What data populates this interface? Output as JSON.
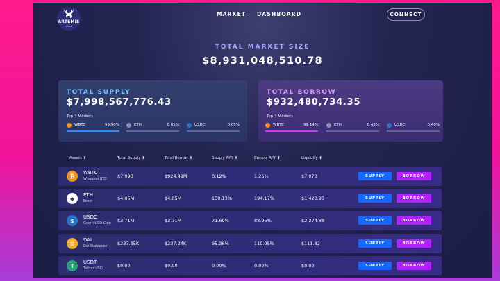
{
  "header": {
    "brand": "ARTEMIS",
    "brand_sub": "aave",
    "nav": [
      "MARKET",
      "DASHBOARD"
    ],
    "connect_label": "CONNECT"
  },
  "market": {
    "label": "TOTAL MARKET SIZE",
    "value": "$8,931,048,510.78"
  },
  "supply_card": {
    "title": "TOTAL SUPPLY",
    "value": "$7,998,567,776.43",
    "top3_label": "Top 3 Markets",
    "markets": [
      {
        "name": "WBTC",
        "pct": "99.90%",
        "fill": 0.999,
        "color": "#f7931a"
      },
      {
        "name": "ETH",
        "pct": "0.05%",
        "fill": 0.0,
        "color": "#8a92b2"
      },
      {
        "name": "USDC",
        "pct": "0.05%",
        "fill": 0.0,
        "color": "#2775ca"
      }
    ]
  },
  "borrow_card": {
    "title": "TOTAL BORROW",
    "value": "$932,480,734.35",
    "top3_label": "Top 3 Markets",
    "markets": [
      {
        "name": "WBTC",
        "pct": "99.14%",
        "fill": 0.9914,
        "color": "#f7931a"
      },
      {
        "name": "ETH",
        "pct": "0.43%",
        "fill": 0.0043,
        "color": "#8a92b2"
      },
      {
        "name": "USDC",
        "pct": "0.40%",
        "fill": 0.004,
        "color": "#2775ca"
      }
    ]
  },
  "table": {
    "headers": [
      "Assets",
      "Total Supply",
      "Total Borrow",
      "Supply APY",
      "Borrow APY",
      "Liquidity"
    ],
    "supply_label": "SUPPLY",
    "borrow_label": "BORROW",
    "rows": [
      {
        "symbol": "WBTC",
        "name": "Wrapped BTC",
        "icon_color": "#f7931a",
        "icon_glyph": "₿",
        "total_supply": "$7.99B",
        "total_borrow": "$924.49M",
        "supply_apy": "0.12%",
        "borrow_apy": "1.25%",
        "liquidity": "$7.07B"
      },
      {
        "symbol": "ETH",
        "name": "Ether",
        "icon_color": "#ffffff",
        "icon_glyph": "◆",
        "total_supply": "$4.05M",
        "total_borrow": "$4.05M",
        "supply_apy": "150.13%",
        "borrow_apy": "194.17%",
        "liquidity": "$1,420.93"
      },
      {
        "symbol": "USDC",
        "name": "Goerli USD Coin",
        "icon_color": "#2775ca",
        "icon_glyph": "$",
        "total_supply": "$3.71M",
        "total_borrow": "$3.71M",
        "supply_apy": "71.69%",
        "borrow_apy": "88.95%",
        "liquidity": "$2,274.88"
      },
      {
        "symbol": "DAI",
        "name": "Dai Stablecoin",
        "icon_color": "#f5ac37",
        "icon_glyph": "≡",
        "total_supply": "$237.35K",
        "total_borrow": "$237.24K",
        "supply_apy": "95.36%",
        "borrow_apy": "119.95%",
        "liquidity": "$111.82"
      },
      {
        "symbol": "USDT",
        "name": "Tether USD",
        "icon_color": "#26a17b",
        "icon_glyph": "T",
        "total_supply": "$0.00",
        "total_borrow": "$0.00",
        "supply_apy": "0.00%",
        "borrow_apy": "0.00%",
        "liquidity": "$0.00"
      }
    ]
  }
}
